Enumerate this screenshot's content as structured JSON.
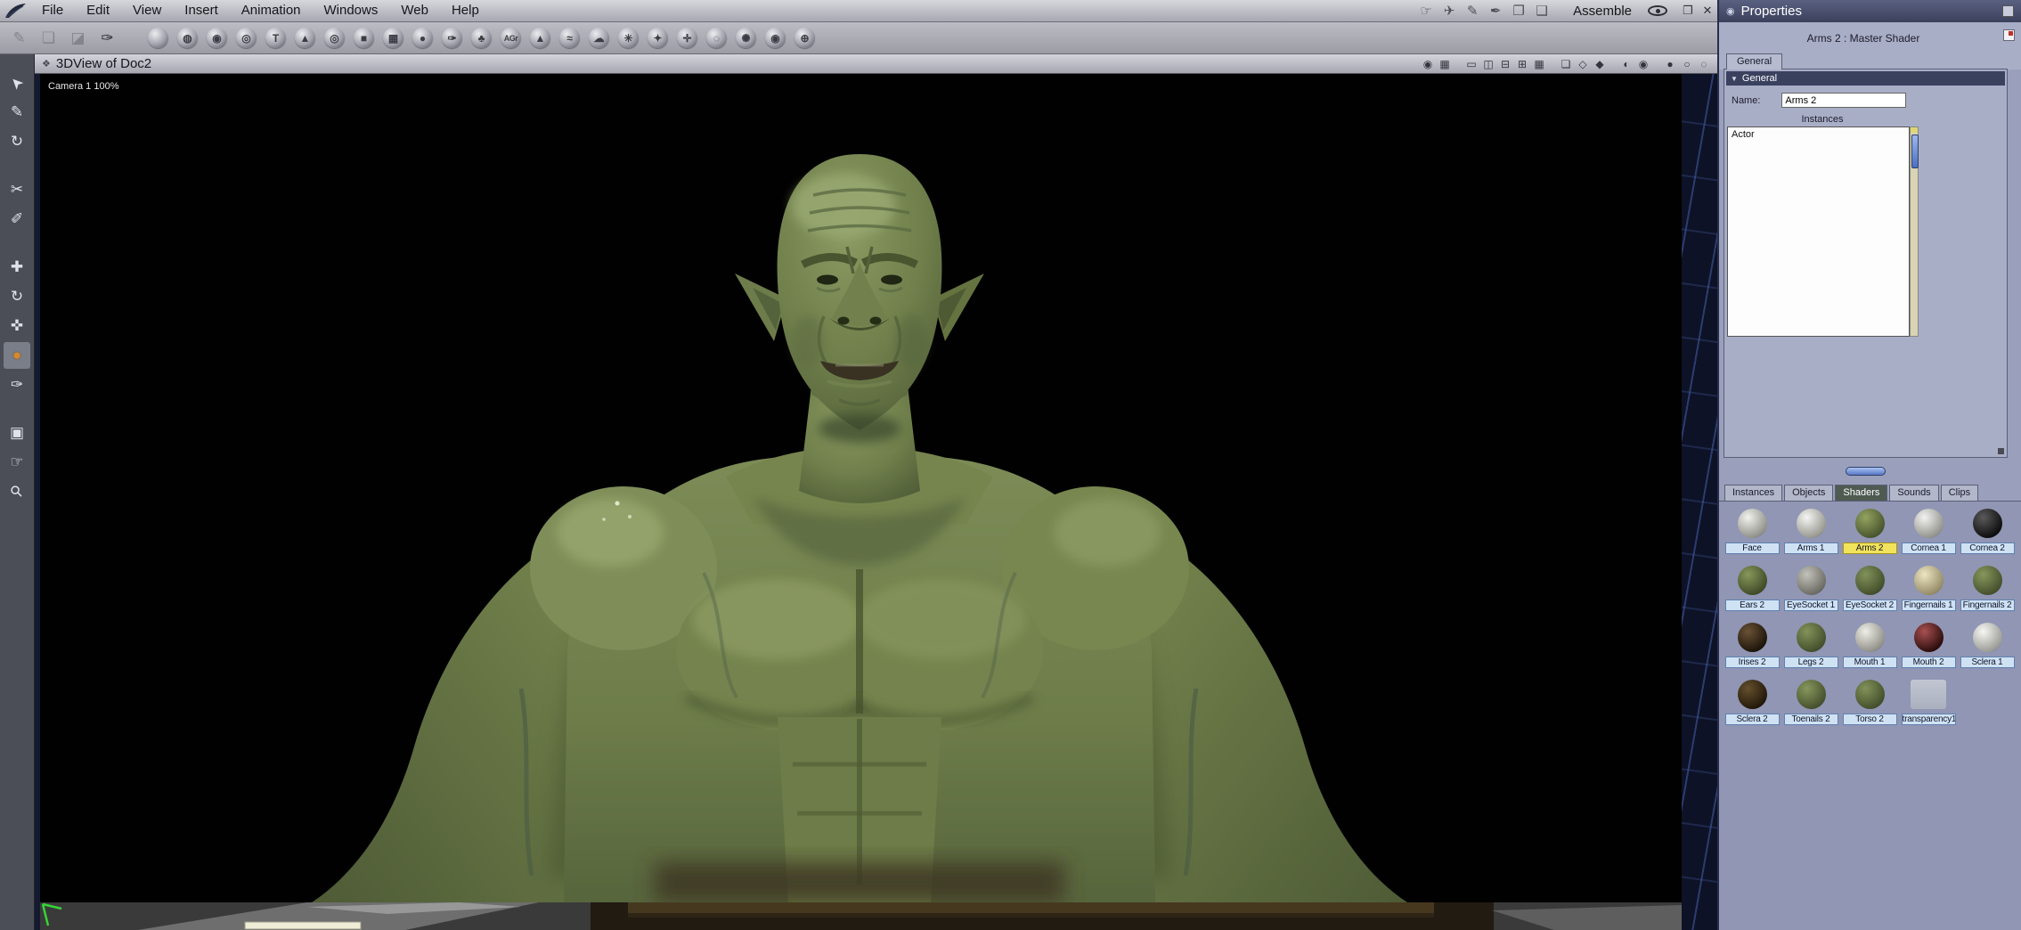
{
  "colors": {
    "selected_label_bg": "#f2e35c",
    "accent_blue": "#5878c8",
    "panel_bg": "#9aa0bb",
    "skin_green": "#75844e"
  },
  "app": {
    "mode_label": "Assemble"
  },
  "menu": {
    "items": [
      {
        "label": "File",
        "name": "menu-file"
      },
      {
        "label": "Edit",
        "name": "menu-edit"
      },
      {
        "label": "View",
        "name": "menu-view"
      },
      {
        "label": "Insert",
        "name": "menu-insert"
      },
      {
        "label": "Animation",
        "name": "menu-animation"
      },
      {
        "label": "Windows",
        "name": "menu-windows"
      },
      {
        "label": "Web",
        "name": "menu-web"
      },
      {
        "label": "Help",
        "name": "menu-help"
      }
    ],
    "right_icons": [
      {
        "name": "pan-hand-icon",
        "glyph": "☞"
      },
      {
        "name": "jet-icon",
        "glyph": "✈"
      },
      {
        "name": "pen-icon",
        "glyph": "✎"
      },
      {
        "name": "ink-pen-icon",
        "glyph": "✒"
      },
      {
        "name": "package-icon",
        "glyph": "❐"
      },
      {
        "name": "package-2-icon",
        "glyph": "❑"
      }
    ],
    "window_icons": [
      {
        "name": "restore-button",
        "glyph": "❐"
      },
      {
        "name": "close-button",
        "glyph": "✕"
      }
    ]
  },
  "toolbar": {
    "edit_icons": [
      {
        "name": "wand-tool-icon",
        "glyph": "✎",
        "cls": "dim"
      },
      {
        "name": "eraser-tool-icon",
        "glyph": "❏",
        "cls": "dim"
      },
      {
        "name": "stamp-tool-icon",
        "glyph": "◪",
        "cls": "dim"
      },
      {
        "name": "paintbrush-tool-icon",
        "glyph": "✑",
        "cls": "dark"
      }
    ],
    "insert_icons": [
      {
        "name": "insert-sphere-icon",
        "glyph": ""
      },
      {
        "name": "insert-vertex-object-icon",
        "glyph": "◍"
      },
      {
        "name": "insert-metaball-icon",
        "glyph": "◉"
      },
      {
        "name": "insert-spline-object-icon",
        "glyph": "◎"
      },
      {
        "name": "insert-text-icon",
        "glyph": "T"
      },
      {
        "name": "insert-cone-icon",
        "glyph": "▲"
      },
      {
        "name": "insert-torus-icon",
        "glyph": "◎"
      },
      {
        "name": "insert-cube-icon",
        "glyph": "■"
      },
      {
        "name": "insert-plane-icon",
        "glyph": "▦"
      },
      {
        "name": "insert-oval-icon",
        "glyph": "●"
      },
      {
        "name": "insert-brush-icon",
        "glyph": "✑"
      },
      {
        "name": "insert-plant-icon",
        "glyph": "♣"
      },
      {
        "name": "insert-agr-icon",
        "glyph": "AGr",
        "cls": "txt"
      },
      {
        "name": "insert-terrain-icon",
        "glyph": "▲"
      },
      {
        "name": "insert-ocean-icon",
        "glyph": "≈"
      },
      {
        "name": "insert-cloud-icon",
        "glyph": "☁"
      },
      {
        "name": "insert-particles-icon",
        "glyph": "✳"
      },
      {
        "name": "insert-fountain-icon",
        "glyph": "✦"
      },
      {
        "name": "insert-bones-icon",
        "glyph": "✛"
      },
      {
        "name": "insert-fog-icon",
        "glyph": "◌"
      },
      {
        "name": "insert-light-icon",
        "glyph": "✺"
      },
      {
        "name": "insert-camera-icon",
        "glyph": "◉"
      },
      {
        "name": "insert-target-icon",
        "glyph": "⊕"
      }
    ]
  },
  "tools": {
    "items": [
      {
        "name": "select-tool-icon",
        "glyph": "➤",
        "cls": "rotUL"
      },
      {
        "name": "paint-select-tool-icon",
        "glyph": "✎"
      },
      {
        "name": "rotate-view-tool-icon",
        "glyph": "↻"
      },
      {
        "name": "knife-tool-icon",
        "glyph": "✂",
        "cls": "gapL"
      },
      {
        "name": "eyedropper-tool-icon",
        "glyph": "✐"
      },
      {
        "name": "move-tool-icon",
        "glyph": "✚",
        "cls": "gapL"
      },
      {
        "name": "rotate-tool-icon",
        "glyph": "↻"
      },
      {
        "name": "scale-tool-icon",
        "glyph": "✜"
      },
      {
        "name": "shader-ball-tool-icon",
        "glyph": "●",
        "cls": "orange sel"
      },
      {
        "name": "paint-tool-icon",
        "glyph": "✑"
      },
      {
        "name": "camera-tool-icon",
        "glyph": "▣",
        "cls": "gapL"
      },
      {
        "name": "pan-tool-icon",
        "glyph": "☞"
      },
      {
        "name": "zoom-tool-icon",
        "glyph": "⚲",
        "cls": "rot45"
      }
    ]
  },
  "viewport": {
    "title": "3DView of Doc2",
    "widget_glyph": "❖",
    "camera_label": "Camera 1 100%",
    "header_icons": [
      {
        "name": "magnet-snap-icon",
        "glyph": "◉"
      },
      {
        "name": "grid-snap-icon",
        "glyph": "▦"
      },
      {
        "name": "layout-single-icon",
        "glyph": "▭",
        "cls": "gml"
      },
      {
        "name": "layout-2v-icon",
        "glyph": "◫"
      },
      {
        "name": "layout-2h-icon",
        "glyph": "⊟"
      },
      {
        "name": "layout-3-icon",
        "glyph": "⊞"
      },
      {
        "name": "layout-4-icon",
        "glyph": "▦"
      },
      {
        "name": "production-frame-icon",
        "glyph": "❏",
        "cls": "gml"
      },
      {
        "name": "wireframe-mode-icon",
        "glyph": "◇"
      },
      {
        "name": "flat-shade-icon",
        "glyph": "◆"
      },
      {
        "name": "smooth-shade-icon",
        "glyph": "◐",
        "cls": "gml"
      },
      {
        "name": "texture-shade-icon",
        "glyph": "◉"
      },
      {
        "name": "preview-sphere-icon",
        "glyph": "●",
        "cls": "gml"
      },
      {
        "name": "wire-sphere-icon",
        "glyph": "○"
      },
      {
        "name": "backdrop-icon",
        "glyph": "◌"
      }
    ]
  },
  "properties": {
    "panel_title": "Properties",
    "panel_icon_glyph": "◉",
    "shader_title": "Arms 2 : Master Shader",
    "general_tab": "General",
    "general_section": "General",
    "collapse_glyph": "▼",
    "name_label": "Name:",
    "name_value": "Arms 2",
    "instances_caption": "Instances",
    "instance_items": [
      {
        "label": "Actor",
        "name": "instance-actor"
      }
    ]
  },
  "browser": {
    "tabs": [
      {
        "label": "Instances",
        "name": "tab-instances",
        "cls": ""
      },
      {
        "label": "Objects",
        "name": "tab-objects",
        "cls": ""
      },
      {
        "label": "Shaders",
        "name": "tab-shaders",
        "cls": "active"
      },
      {
        "label": "Sounds",
        "name": "tab-sounds",
        "cls": ""
      },
      {
        "label": "Clips",
        "name": "tab-clips",
        "cls": ""
      }
    ],
    "shaders": [
      {
        "label": "Face",
        "name": "shader-face",
        "c1": "#f2f2ee",
        "c2": "#8f8f88"
      },
      {
        "label": "Arms 1",
        "name": "shader-arms-1",
        "c1": "#f4f4f2",
        "c2": "#97978f"
      },
      {
        "label": "Arms 2",
        "name": "shader-arms-2",
        "c1": "#93a35f",
        "c2": "#49542e",
        "label_cls": "selected"
      },
      {
        "label": "Cornea 1",
        "name": "shader-cornea-1",
        "c1": "#f2f2f0",
        "c2": "#92928c"
      },
      {
        "label": "Cornea 2",
        "name": "shader-cornea-2",
        "c1": "#5a5a5a",
        "c2": "#0c0c0c"
      },
      {
        "label": "Ears 2",
        "name": "shader-ears-2",
        "c1": "#87975a",
        "c2": "#404a28"
      },
      {
        "label": "EyeSocket 1",
        "name": "shader-eyesocket-1",
        "c1": "#c2c2ba",
        "c2": "#6a6a62"
      },
      {
        "label": "EyeSocket 2",
        "name": "shader-eyesocket-2",
        "c1": "#82925a",
        "c2": "#434e2b"
      },
      {
        "label": "Fingernails 1",
        "name": "shader-fingernails-1",
        "c1": "#ece4c2",
        "c2": "#948a66"
      },
      {
        "label": "Fingernails 2",
        "name": "shader-fingernails-2",
        "c1": "#87975c",
        "c2": "#454f2c"
      },
      {
        "label": "Irises 2",
        "name": "shader-irises-2",
        "c1": "#6a5234",
        "c2": "#1c140a"
      },
      {
        "label": "Legs 2",
        "name": "shader-legs-2",
        "c1": "#83935a",
        "c2": "#434e2b"
      },
      {
        "label": "Mouth 1",
        "name": "shader-mouth-1",
        "c1": "#eeeee8",
        "c2": "#8f8f87"
      },
      {
        "label": "Mouth 2",
        "name": "shader-mouth-2",
        "c1": "#a85050",
        "c2": "#2a0c0c"
      },
      {
        "label": "Sclera 1",
        "name": "shader-sclera-1",
        "c1": "#f6f6f4",
        "c2": "#9a9a94"
      },
      {
        "label": "Sclera 2",
        "name": "shader-sclera-2",
        "c1": "#64502e",
        "c2": "#221708"
      },
      {
        "label": "Toenails 2",
        "name": "shader-toenails-2",
        "c1": "#87975c",
        "c2": "#454f2c"
      },
      {
        "label": "Torso 2",
        "name": "shader-torso-2",
        "c1": "#82925a",
        "c2": "#434e2b"
      },
      {
        "label": "transparency1",
        "name": "shader-transparency1",
        "c1": "#babeca",
        "c2": "#a6aab8",
        "sphere_cls": "flat"
      }
    ]
  }
}
